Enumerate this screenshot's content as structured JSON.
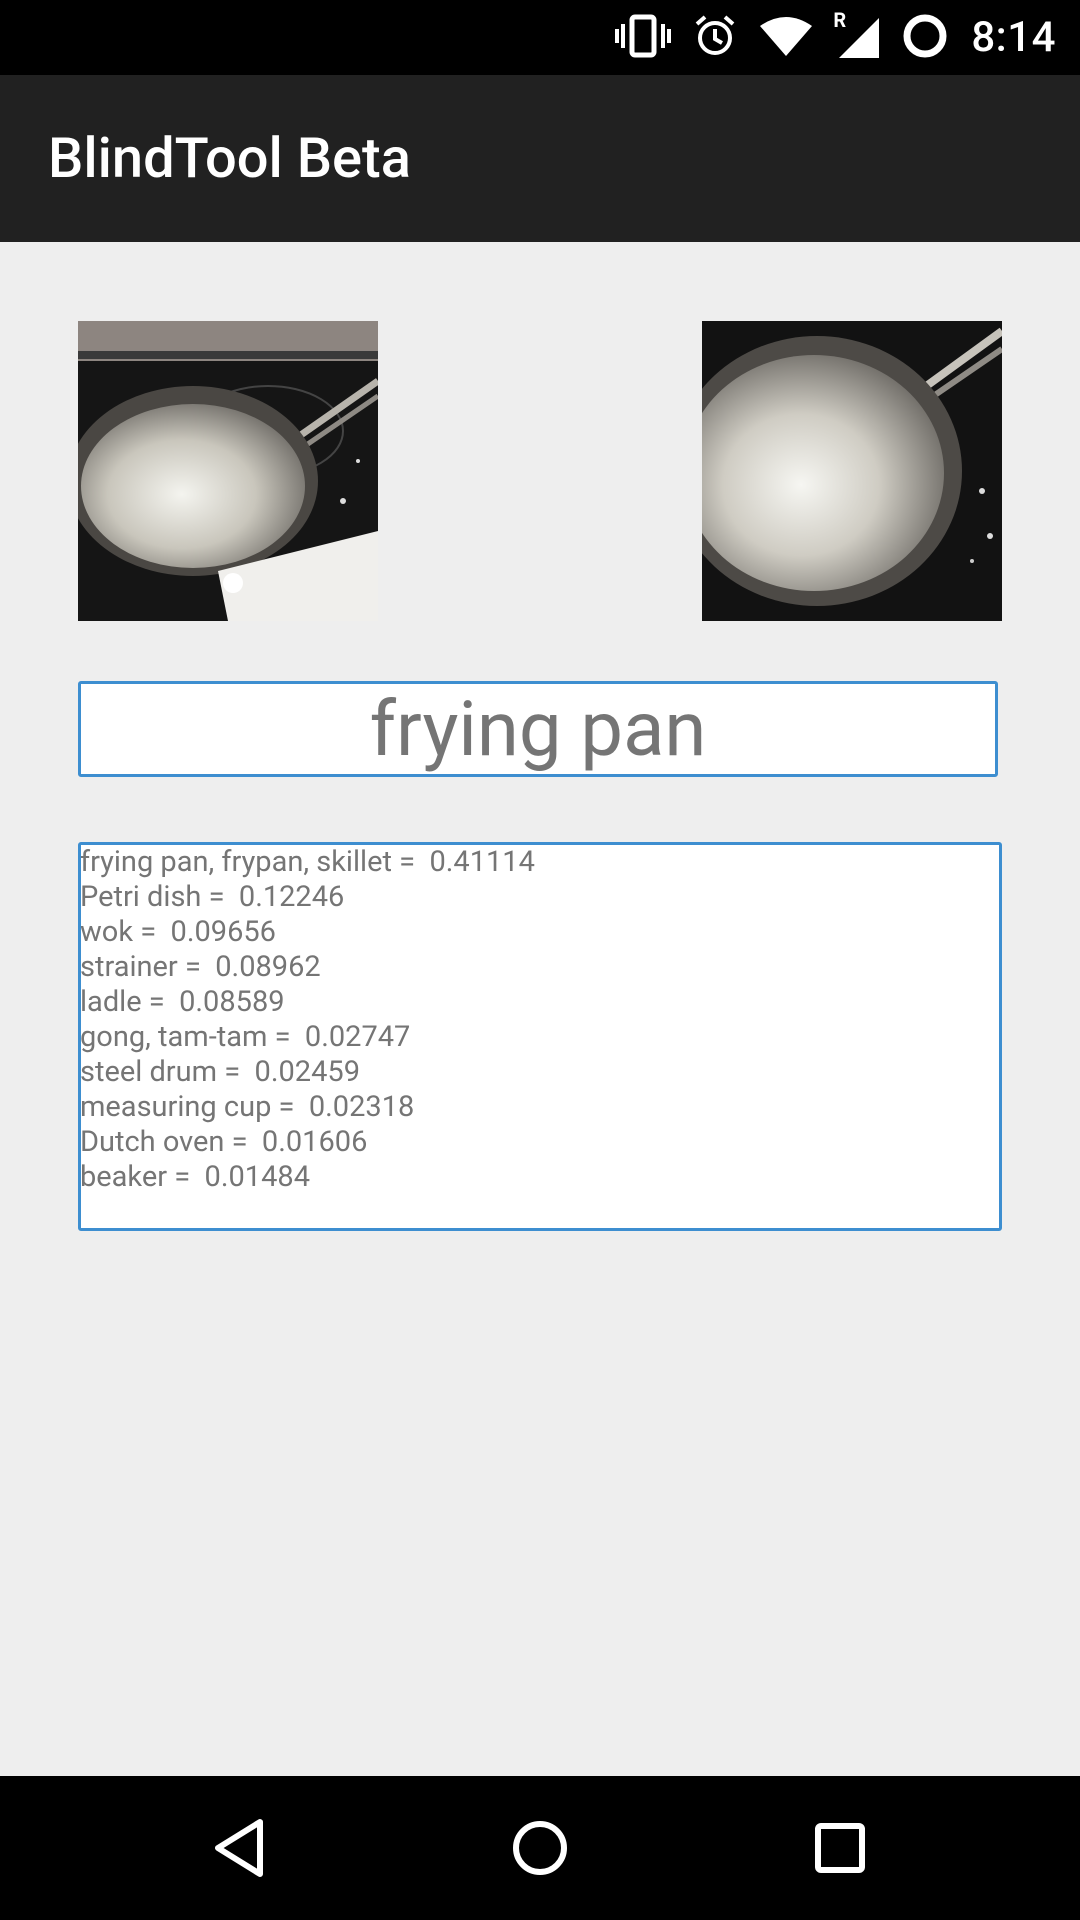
{
  "status_bar": {
    "time": "8:14",
    "icons": [
      "vibrate-icon",
      "alarm-icon",
      "wifi-icon",
      "signal-roaming-icon",
      "battery-icon"
    ],
    "roaming_indicator": "R"
  },
  "app_bar": {
    "title": "BlindTool Beta"
  },
  "thumbnails": [
    {
      "name": "camera-frame-left",
      "description_icon": "frying-pan-photo"
    },
    {
      "name": "camera-frame-right",
      "description_icon": "frying-pan-photo"
    }
  ],
  "prediction": {
    "label": "frying pan"
  },
  "results": [
    "frying pan, frypan, skillet =  0.41114",
    "Petri dish =  0.12246",
    "wok =  0.09656",
    "strainer =  0.08962",
    "ladle =  0.08589",
    "gong, tam-tam =  0.02747",
    "steel drum =  0.02459",
    "measuring cup =  0.02318",
    "Dutch oven =  0.01606",
    "beaker =  0.01484"
  ],
  "nav_bar": {
    "buttons": [
      "back-icon",
      "home-icon",
      "recents-icon"
    ]
  },
  "colors": {
    "accent": "#3d8ed0",
    "app_bar": "#212121",
    "background": "#eeeeee",
    "text_gray": "#757575"
  }
}
